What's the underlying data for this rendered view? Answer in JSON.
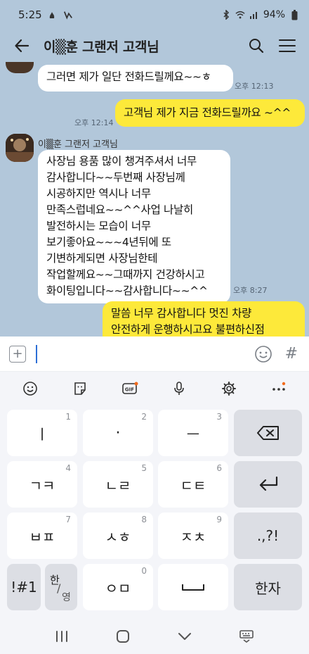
{
  "status": {
    "time": "5:25",
    "battery": "94%"
  },
  "header": {
    "title": "이▒훈 그랜저 고객님"
  },
  "messages": [
    {
      "text": "그러면 제가 일단 전화드릴께요~~ㅎ",
      "time": "오후 12:13"
    },
    {
      "text": "고객님 제가 지금 전화드릴까요 ~^^",
      "time": "오후 12:14"
    },
    {
      "sender": "이▒훈 그랜저 고객님",
      "lines": [
        "사장님 용품 많이 챙겨주셔서 너무",
        "감사합니다~~두번째 사장님께",
        "시공하지만 역시나 너무",
        "만족스럽네요~~^^사업 나날히",
        "발전하시는 모습이 너무",
        "보기좋아요~~~4년뒤에 또",
        "기변하게되면 사장님한테",
        "작업할께요~~그때까지 건강하시고",
        "화이팅입니다~~감사합니다~~^^"
      ],
      "time": "오후 8:27"
    },
    {
      "lines": [
        "말씀 너무 감사합니다 멋진 차량",
        "안전하게 운행하시고요 불편하신점"
      ]
    }
  ],
  "input": {
    "value": "",
    "sharp": "#"
  },
  "keys": {
    "r1": [
      {
        "label": "ㅣ",
        "num": "1"
      },
      {
        "label": "·",
        "num": "2"
      },
      {
        "label": "ㅡ",
        "num": "3"
      }
    ],
    "r2": [
      {
        "label": "ㄱㅋ",
        "num": "4"
      },
      {
        "label": "ㄴㄹ",
        "num": "5"
      },
      {
        "label": "ㄷㅌ",
        "num": "6"
      }
    ],
    "r3": [
      {
        "label": "ㅂㅍ",
        "num": "7"
      },
      {
        "label": "ㅅㅎ",
        "num": "8"
      },
      {
        "label": "ㅈㅊ",
        "num": "9"
      }
    ],
    "punct": ".,?!",
    "sym": "!#1",
    "lang_top": "한",
    "lang_bottom": "영",
    "zero": {
      "label": "ㅇㅁ",
      "num": "0"
    },
    "hanja": "한자"
  },
  "colors": {
    "chat_bg": "#b2c7da",
    "outgoing": "#fde93a",
    "incoming": "#ffffff",
    "keyboard_bg": "#f4f5f9"
  }
}
